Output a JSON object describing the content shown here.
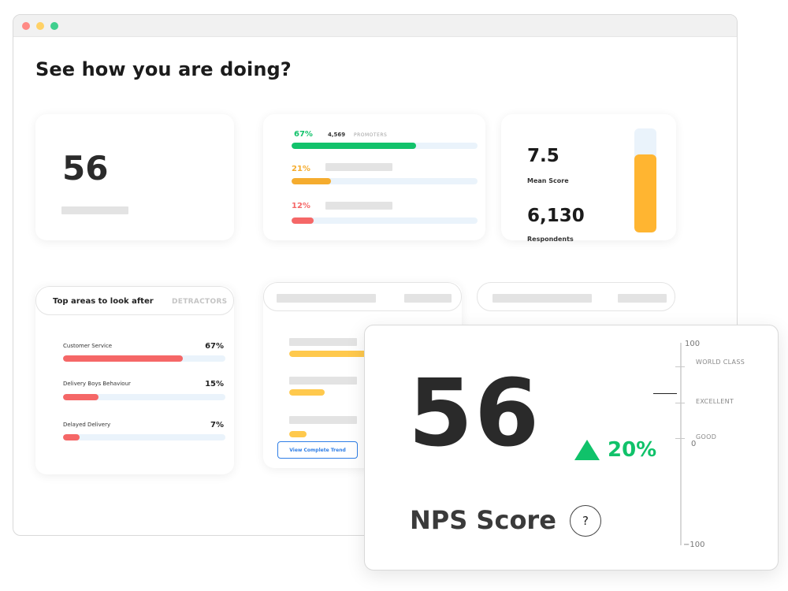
{
  "page": {
    "title": "See how you are doing?"
  },
  "score_card": {
    "value": "56"
  },
  "distribution": {
    "rows": [
      {
        "pct": "67%",
        "count": "4,569",
        "label": "PROMOTERS",
        "level": 0.67,
        "color": "#12c26b"
      },
      {
        "pct": "21%",
        "level": 0.21,
        "color": "#f5ac2e"
      },
      {
        "pct": "12%",
        "level": 0.12,
        "color": "#f56767"
      }
    ]
  },
  "mean_card": {
    "mean_value": "7.5",
    "mean_label": "Mean Score",
    "respondents_value": "6,130",
    "respondents_label": "Respondents",
    "bar_level": 0.75,
    "bar_color": "#ffb531"
  },
  "areas": {
    "title": "Top areas to look after",
    "tab": "DETRACTORS",
    "rows": [
      {
        "label": "Customer Service",
        "pct": "67%",
        "level": 0.74
      },
      {
        "label": "Delivery Boys Behaviour",
        "pct": "15%",
        "level": 0.22
      },
      {
        "label": "Delayed Delivery",
        "pct": "7%",
        "level": 0.1
      }
    ],
    "color": "#f56767"
  },
  "trend": {
    "button_label": "View Complete Trend",
    "levels": [
      0.62,
      0.28,
      0.14
    ],
    "color": "#ffc94d"
  },
  "nps": {
    "score": "56",
    "change": "20%",
    "label": "NPS Score",
    "help": "?",
    "scale": {
      "max": "100",
      "mid": "0",
      "min": "−100",
      "categories": [
        "WORLD CLASS",
        "EXCELLENT",
        "GOOD"
      ]
    },
    "change_color": "#10c26a"
  }
}
